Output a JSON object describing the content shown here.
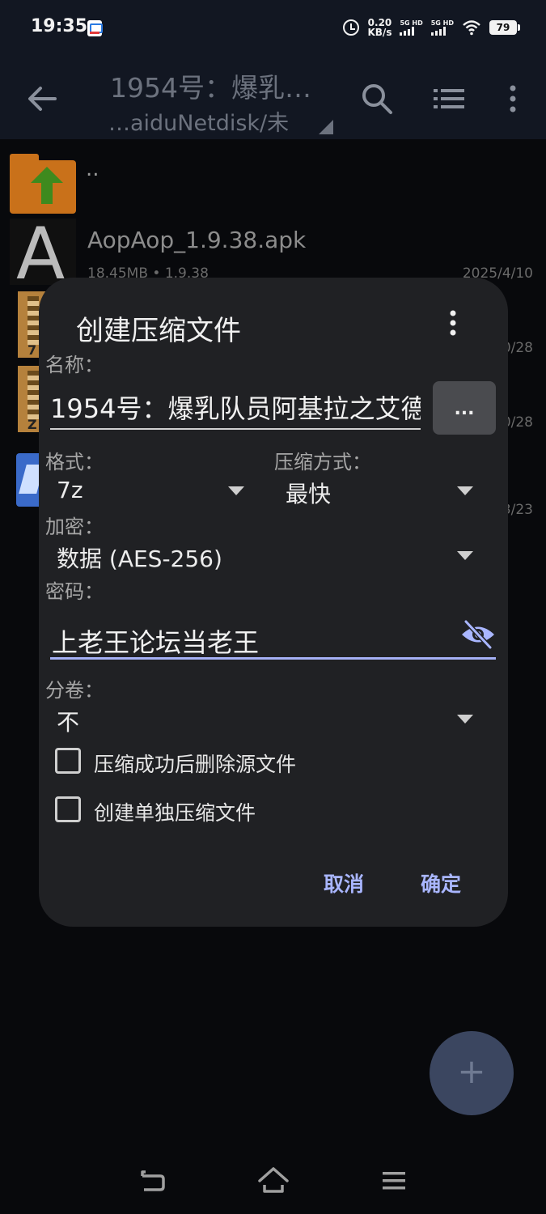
{
  "status_bar": {
    "time": "19:35",
    "net_speed_value": "0.20",
    "net_speed_unit": "KB/s",
    "sim1_label": "5G HD",
    "sim2_label": "5G HD",
    "battery": "79"
  },
  "toolbar": {
    "title": "1954号：爆乳…",
    "subtitle": "…aiduNetdisk/未",
    "icons": [
      "back-arrow-icon",
      "search-icon",
      "list-view-icon",
      "more-vert-icon"
    ]
  },
  "file_list": {
    "parent_label": "..",
    "items": [
      {
        "name": "AopAop_1.9.38.apk",
        "size": "18.45MB",
        "version": "• 1.9.38",
        "date": "2025/4/10",
        "thumb_letter": "A"
      },
      {
        "date": "0/28",
        "zip_label": "7"
      },
      {
        "date": "0/28",
        "zip_label": "Z"
      },
      {
        "date": "3/23"
      }
    ]
  },
  "dialog": {
    "title": "创建压缩文件",
    "name_label": "名称：",
    "name_value": "1954号：爆乳队员阿基拉之艾德",
    "browse_label": "...",
    "format_label": "格式：",
    "format_value": "7z",
    "method_label": "压缩方式：",
    "method_value": "最快",
    "encrypt_label": "加密：",
    "encrypt_value": "数据 (AES-256)",
    "password_label": "密码：",
    "password_value": "上老王论坛当老王",
    "split_label": "分卷：",
    "split_value": "不",
    "delete_source_label": "压缩成功后删除源文件",
    "separate_archive_label": "创建单独压缩文件",
    "cancel_label": "取消",
    "ok_label": "确定"
  },
  "fab": {
    "label": "+"
  },
  "colors": {
    "accent": "#a9b6ff",
    "dialog_bg": "#202124",
    "toolbar_bg": "#121722",
    "folder": "#c9711a"
  }
}
